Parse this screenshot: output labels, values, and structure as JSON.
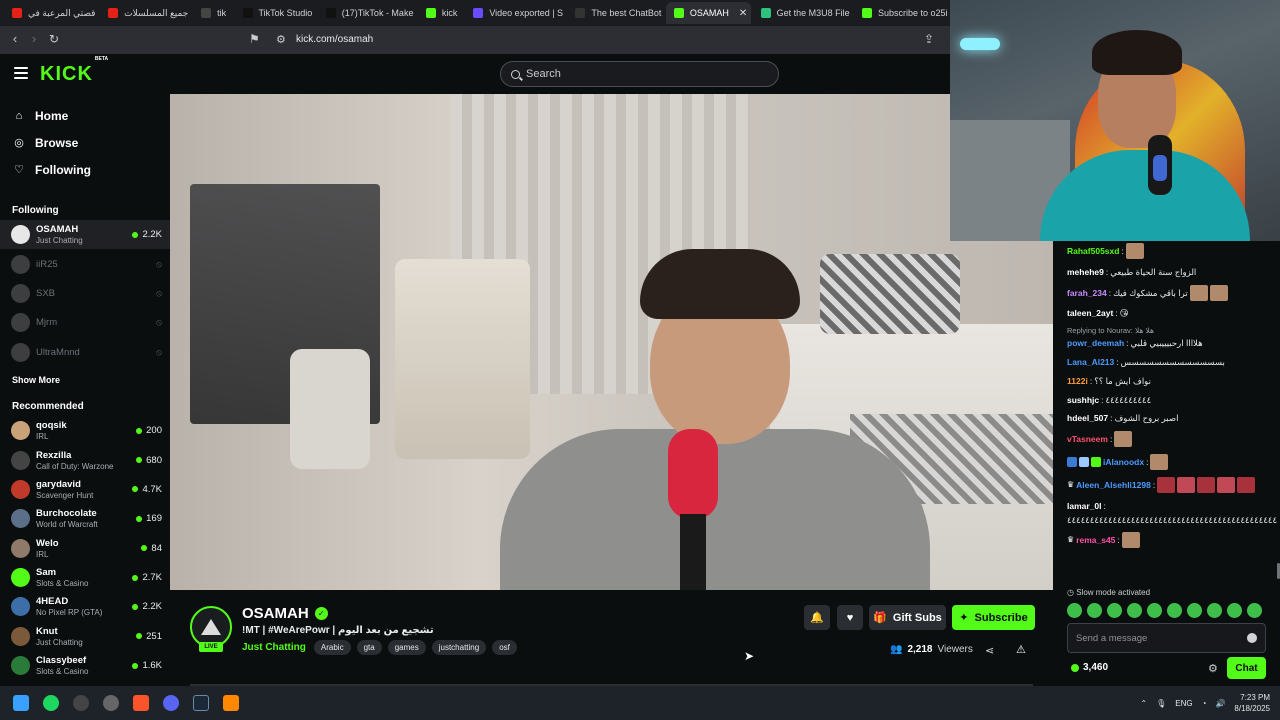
{
  "browser": {
    "tabs": [
      {
        "label": "قصتي المرعبة في",
        "color": "#e62117"
      },
      {
        "label": "جميع المسلسلات",
        "color": "#e62117"
      },
      {
        "label": "tik",
        "color": "#444"
      },
      {
        "label": "TikTok Studio",
        "color": "#111"
      },
      {
        "label": "(17)TikTok - Make",
        "color": "#111"
      },
      {
        "label": "kick",
        "color": "#53fc18"
      },
      {
        "label": "Video exported | S",
        "color": "#6a4cff"
      },
      {
        "label": "The best ChatBot",
        "color": "#333"
      },
      {
        "label": "OSAMAH",
        "color": "#53fc18"
      },
      {
        "label": "Get the M3U8 File",
        "color": "#2ec27e"
      },
      {
        "label": "Subscribe to o25i",
        "color": "#53fc18"
      }
    ],
    "url": "kick.com/osamah"
  },
  "header": {
    "logo": "KICK",
    "logo_beta": "BETA",
    "search_placeholder": "Search"
  },
  "sidebar": {
    "nav": [
      {
        "label": "Home",
        "icon": "home-icon"
      },
      {
        "label": "Browse",
        "icon": "compass-icon"
      },
      {
        "label": "Following",
        "icon": "heart-icon"
      }
    ],
    "following_title": "Following",
    "following": [
      {
        "name": "OSAMAH",
        "category": "Just Chatting",
        "viewers": "2.2K",
        "live": true,
        "color": "#e7e7e7"
      },
      {
        "name": "iiR25",
        "category": "",
        "viewers": "",
        "live": false,
        "color": "#888"
      },
      {
        "name": "SXB",
        "category": "",
        "viewers": "",
        "live": false,
        "color": "#888"
      },
      {
        "name": "Mjrm",
        "category": "",
        "viewers": "",
        "live": false,
        "color": "#888"
      },
      {
        "name": "UltraMnnd",
        "category": "",
        "viewers": "",
        "live": false,
        "color": "#888"
      }
    ],
    "show_more": "Show More",
    "recommended_title": "Recommended",
    "recommended": [
      {
        "name": "qoqsik",
        "category": "IRL",
        "viewers": "200",
        "color": "#c9a27a"
      },
      {
        "name": "Rexzilla",
        "category": "Call of Duty: Warzone",
        "viewers": "680",
        "color": "#444"
      },
      {
        "name": "garydavid",
        "category": "Scavenger Hunt",
        "viewers": "4.7K",
        "color": "#c0392b"
      },
      {
        "name": "Burchocolate",
        "category": "World of Warcraft",
        "viewers": "169",
        "color": "#5b6f88"
      },
      {
        "name": "Welo",
        "category": "IRL",
        "viewers": "84",
        "color": "#8f7a6a"
      },
      {
        "name": "Sam",
        "category": "Slots & Casino",
        "viewers": "2.7K",
        "color": "#53fc18"
      },
      {
        "name": "4HEAD",
        "category": "No Pixel RP (GTA)",
        "viewers": "2.2K",
        "color": "#3d6ea8"
      },
      {
        "name": "Knut",
        "category": "Just Chatting",
        "viewers": "251",
        "color": "#7a5a3a"
      },
      {
        "name": "Classybeef",
        "category": "Slots & Casino",
        "viewers": "1.6K",
        "color": "#2a7a3a"
      }
    ]
  },
  "stream": {
    "name": "OSAMAH",
    "live_badge": "LIVE",
    "title_prefix": "!MT |  #WeArePowr | ",
    "title_arabic": "تشجيع من بعد اليوم",
    "category": "Just Chatting",
    "tags": [
      "Arabic",
      "gta",
      "games",
      "justchatting",
      "osf"
    ],
    "gift_label": "Gift Subs",
    "subscribe_label": "Subscribe",
    "viewers": "2,218",
    "viewers_label": "Viewers"
  },
  "chat": {
    "messages": [
      {
        "user": "Rahaf505sxd",
        "color": "#53fc18",
        "text": "",
        "emotes": 1
      },
      {
        "user": "mehehe9",
        "color": "#ffffff",
        "text": "الزواج سنة الحياة طبيعي",
        "emotes": 0
      },
      {
        "user": "farah_234",
        "color": "#c78bff",
        "text": "ترا باقي مشكوك فيك",
        "emotes": 2
      },
      {
        "user": "taleen_2ayt",
        "color": "#ffffff",
        "text": "😘",
        "emotes": 0
      },
      {
        "reply": "Replying to Nourav: هلا هلا",
        "user": "powr_deemah",
        "color": "#4b9bff",
        "text": "هلاااا ارحبيييبيي قلبي",
        "emotes": 0
      },
      {
        "user": "Lana_Al213",
        "color": "#4b9bff",
        "text": "بسسسسسسسسسسسسس",
        "emotes": 0
      },
      {
        "user": "1122i",
        "color": "#ff9c3a",
        "text": "نواف ايش ما ؟؟",
        "emotes": 0
      },
      {
        "user": "sushhjc",
        "color": "#ffffff",
        "text": "٤٤٤٤٤٤٤٤٤٤",
        "emotes": 0
      },
      {
        "user": "hdeel_507",
        "color": "#ffffff",
        "text": "اصبر بروح الشوف",
        "emotes": 0
      },
      {
        "user": "vTasneem",
        "color": "#ff4f6d",
        "text": "",
        "emotes": 1
      },
      {
        "user": "iAlanoodx",
        "color": "#4b9bff",
        "text": "",
        "emotes": 1,
        "badges": true
      },
      {
        "user": "Aleen_Alsehli1298",
        "color": "#4b9bff",
        "text": "",
        "emotes": 5,
        "crown": true
      },
      {
        "user": "lamar_0l",
        "color": "#ffffff",
        "text": "٤٤٤٤٤٤٤٤٤٤٤٤٤٤٤٤٤٤٤٤٤٤٤٤٤٤٤٤٤٤٤٤٤٤٤٤٤٤٤٤٤٤٤٤٤٤٤٤٤٤٤٤٤٤٤٤٤٤٤",
        "emotes": 0
      },
      {
        "user": "rema_s45",
        "color": "#ff4fa8",
        "text": "",
        "emotes": 1,
        "crown": true
      }
    ],
    "slow_mode": "Slow mode activated",
    "input_placeholder": "Send a message",
    "points": "3,460",
    "chat_button": "Chat"
  },
  "taskbar": {
    "language": "ENG",
    "time": "7:23 PM",
    "date": "8/18/2025"
  }
}
